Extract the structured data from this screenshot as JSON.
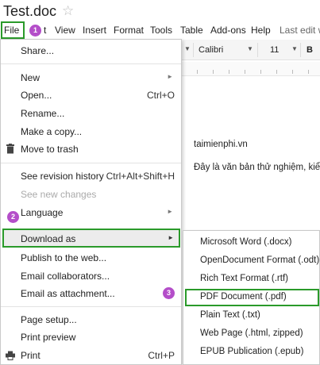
{
  "title": {
    "doc_name": "Test.doc",
    "star_icon": "star-outline-icon"
  },
  "menubar": {
    "items": [
      "File",
      "Edit",
      "View",
      "Insert",
      "Format",
      "Tools",
      "Table",
      "Add-ons",
      "Help"
    ],
    "edit_partial": "t",
    "last_edit": "Last edit w"
  },
  "toolbar": {
    "font": "Calibri",
    "size": "11",
    "bold": "B"
  },
  "document": {
    "line1": "taimienphi.vn",
    "line2": "Đây là văn bản thử nghiệm, kiểm"
  },
  "file_menu": {
    "share": "Share...",
    "new": "New",
    "open": "Open...",
    "open_shortcut": "Ctrl+O",
    "rename": "Rename...",
    "make_copy": "Make a copy...",
    "move_to_trash": "Move to trash",
    "revision_history": "See revision history",
    "revision_history_shortcut": "Ctrl+Alt+Shift+H",
    "new_changes": "See new changes",
    "language": "Language",
    "download_as": "Download as",
    "publish": "Publish to the web...",
    "email_collaborators": "Email collaborators...",
    "email_attachment": "Email as attachment...",
    "page_setup": "Page setup...",
    "print_preview": "Print preview",
    "print": "Print",
    "print_shortcut": "Ctrl+P"
  },
  "download_submenu": {
    "items": [
      "Microsoft Word (.docx)",
      "OpenDocument Format (.odt)",
      "Rich Text Format (.rtf)",
      "PDF Document (.pdf)",
      "Plain Text (.txt)",
      "Web Page (.html, zipped)",
      "EPUB Publication (.epub)"
    ]
  },
  "badges": [
    "1",
    "2",
    "3"
  ],
  "colors": {
    "highlight_border": "#2a9a2a",
    "badge": "#b44ec9"
  }
}
